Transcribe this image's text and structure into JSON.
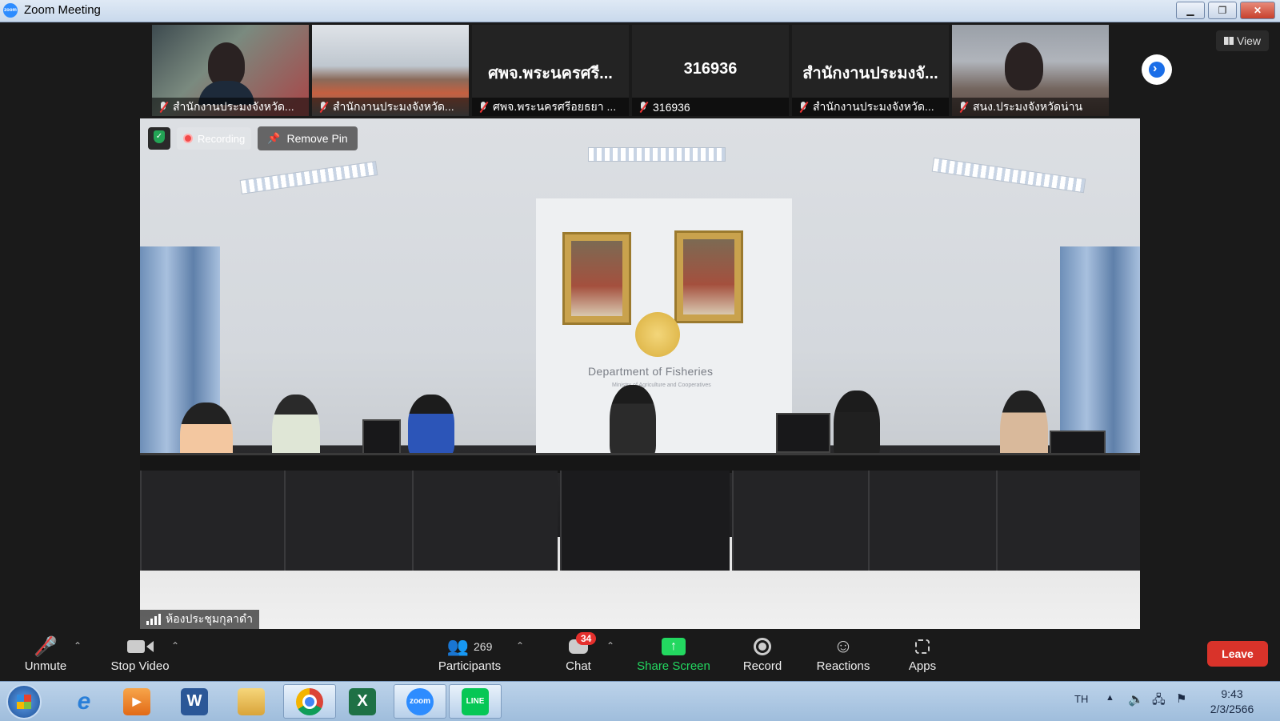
{
  "window": {
    "title": "Zoom Meeting",
    "logo_text": "zoom"
  },
  "view_button": {
    "label": "View"
  },
  "thumbnails": [
    {
      "type": "video",
      "caption": "สำนักงานประมงจังหวัด..."
    },
    {
      "type": "video",
      "caption": "สำนักงานประมงจังหวัด..."
    },
    {
      "type": "name",
      "display_name": "ศพจ.พระนครศรี...",
      "caption": "ศพจ.พระนครศรีอยธยา ..."
    },
    {
      "type": "name",
      "display_name": "316936",
      "caption": "316936"
    },
    {
      "type": "name",
      "display_name": "สำนักงานประมงจั...",
      "caption": "สำนักงานประมงจังหวัด..."
    },
    {
      "type": "video",
      "caption": "สนง.ประมงจังหวัดน่าน"
    }
  ],
  "pinned": {
    "recording_label": "Recording",
    "remove_pin_label": "Remove Pin",
    "room_caption": "ห้องประชุมกุลาดำ",
    "sign_text": "Department of Fisheries",
    "sign_subtext": "Ministry of Agriculture and Cooperatives"
  },
  "toolbar": {
    "unmute": "Unmute",
    "stop_video": "Stop Video",
    "participants": "Participants",
    "participants_count": "269",
    "chat": "Chat",
    "chat_badge": "34",
    "share_screen": "Share Screen",
    "record": "Record",
    "reactions": "Reactions",
    "apps": "Apps",
    "leave": "Leave"
  },
  "taskbar": {
    "apps": [
      "ie",
      "media-player",
      "word",
      "explorer",
      "chrome",
      "excel",
      "zoom",
      "line"
    ],
    "word_glyph": "W",
    "excel_glyph": "X",
    "zoom_glyph": "zoom",
    "line_glyph": "LINE",
    "language": "TH",
    "time": "9:43",
    "date": "2/3/2566"
  },
  "colors": {
    "accent_green": "#23d860",
    "leave_red": "#d9332a",
    "zoom_blue": "#2d8cff",
    "badge_red": "#e5302d"
  }
}
